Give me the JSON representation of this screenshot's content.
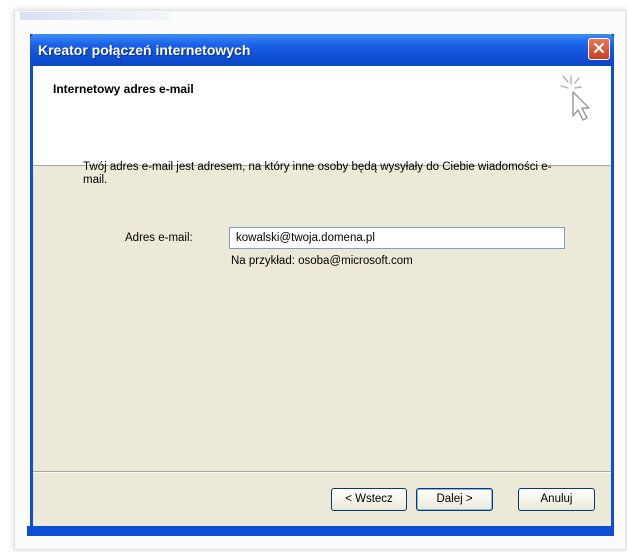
{
  "window": {
    "title": "Kreator połączeń internetowych",
    "title_color": "#0f4fd6"
  },
  "header": {
    "title": "Internetowy adres e-mail"
  },
  "main": {
    "description": "Twój adres e-mail jest adresem, na który inne osoby będą wysyłały do Ciebie wiadomości e-mail.",
    "email_label": "Adres e-mail:",
    "email_value": "kowalski@twoja.domena.pl",
    "example": "Na przykład: osoba@microsoft.com"
  },
  "buttons": {
    "back": "< Wstecz",
    "next": "Dalej >",
    "cancel": "Anuluj"
  },
  "icons": {
    "close": "close-icon",
    "wizard": "cursor-sparkle-icon"
  }
}
